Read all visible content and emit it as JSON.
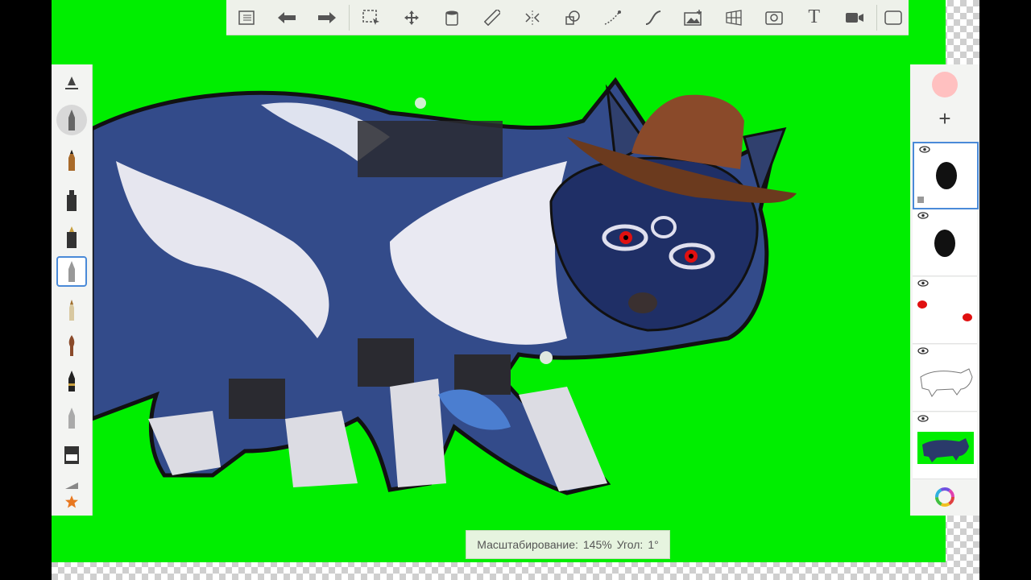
{
  "toolbar": {
    "icons": [
      "list-icon",
      "undo-icon",
      "redo-icon",
      "selection-icon",
      "transform-icon",
      "fill-icon",
      "ruler-icon",
      "symmetry-icon",
      "shapes-icon",
      "curve-icon",
      "stroke-icon",
      "import-image-icon",
      "perspective-icon",
      "time-lapse-icon",
      "text-icon",
      "video-icon",
      "fullscreen-icon"
    ],
    "text_tool_label": "T"
  },
  "left_tools": [
    "brush-settings-icon",
    "airbrush-icon",
    "pencil-icon",
    "ink-pen-icon",
    "marker-icon",
    "ballpoint-pen-icon",
    "fineliner-icon",
    "paintbrush-icon",
    "calligraphy-icon",
    "smudge-icon",
    "eraser-icon",
    "ruler-edge-icon",
    "favorites-star-icon"
  ],
  "left_active_tool": "ballpoint-pen-icon",
  "layers_panel": {
    "add_label": "+",
    "layers": [
      {
        "name": "layer-black-blob",
        "selected": true
      },
      {
        "name": "layer-black-blob-2",
        "selected": false
      },
      {
        "name": "layer-red-eyes",
        "selected": false
      },
      {
        "name": "layer-sketch-outline",
        "selected": false
      },
      {
        "name": "layer-background-wolf",
        "selected": false
      }
    ],
    "current_color": "#ffc0c0"
  },
  "status": {
    "zoom_label": "Масштабирование:",
    "zoom_value": "145%",
    "angle_label": "Угол:",
    "angle_value": "1°"
  },
  "colors": {
    "canvas_bg": "#00ee00",
    "accent": "#4a8ad8"
  }
}
